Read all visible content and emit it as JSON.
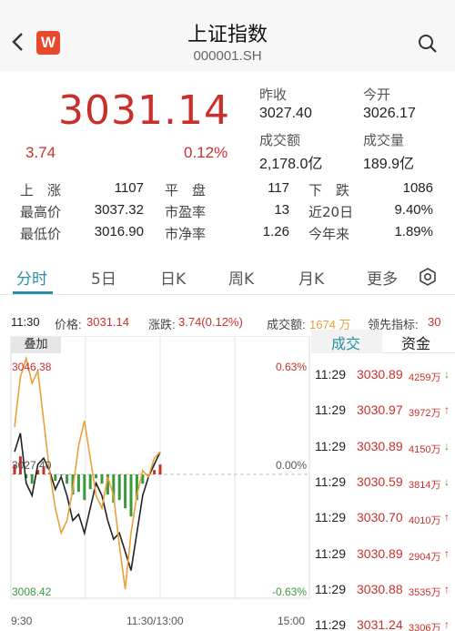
{
  "header": {
    "title": "上证指数",
    "code": "000001.SH",
    "logo_letter": "W"
  },
  "quote": {
    "price": "3031.14",
    "change": "3.74",
    "change_pct": "0.12%",
    "fields": [
      {
        "label": "昨收",
        "value": "3027.40"
      },
      {
        "label": "今开",
        "value": "3026.17"
      },
      {
        "label": "成交额",
        "value": "2,178.0亿"
      },
      {
        "label": "成交量",
        "value": "189.9亿"
      }
    ]
  },
  "stats": [
    {
      "label": "上　涨",
      "value": "1107"
    },
    {
      "label": "平　盘",
      "value": "117"
    },
    {
      "label": "下　跌",
      "value": "1086"
    },
    {
      "label": "最高价",
      "value": "3037.32"
    },
    {
      "label": "市盈率",
      "value": "13"
    },
    {
      "label": "近20日",
      "value": "9.40%"
    },
    {
      "label": "最低价",
      "value": "3016.90"
    },
    {
      "label": "市净率",
      "value": "1.26"
    },
    {
      "label": "今年来",
      "value": "1.89%"
    }
  ],
  "tabs": [
    "分时",
    "5日",
    "日K",
    "周K",
    "月K",
    "更多"
  ],
  "info_bar": {
    "time": "11:30",
    "price_label": "价格:",
    "price": "3031.14",
    "change_label": "涨跌:",
    "change": "3.74(0.12%)",
    "volume_label": "成交额:",
    "volume": "1674 万",
    "leader_label": "领先指标:",
    "leader": "30"
  },
  "chart": {
    "overlay_label": "叠加",
    "y_top": "3046.38",
    "y_mid": "3027.40",
    "y_bottom": "3008.42",
    "pct_top": "0.63%",
    "pct_mid": "0.00%",
    "pct_bottom": "-0.63%",
    "x_start": "9:30",
    "x_mid": "11:30/13:00",
    "x_end": "15:00"
  },
  "chart_data": {
    "type": "line",
    "x_range": [
      "9:30",
      "15:00"
    ],
    "ylim": [
      3008.42,
      3046.38
    ],
    "baseline": 3027.4,
    "series": [
      {
        "values": [
          3031,
          3034,
          3026,
          3024,
          3029,
          3030,
          3028,
          3025,
          3027,
          3024,
          3020,
          3021,
          3018,
          3022,
          3026,
          3024,
          3020,
          3017,
          3018,
          3015,
          3012,
          3018,
          3024,
          3027,
          3029,
          3031
        ]
      },
      {
        "values": [
          3035,
          3043,
          3046,
          3042,
          3044,
          3036,
          3028,
          3022,
          3018,
          3020,
          3025,
          3032,
          3036,
          3030,
          3024,
          3022,
          3027,
          3024,
          3016,
          3009,
          3018,
          3024,
          3028,
          3027,
          3030,
          3031
        ]
      }
    ],
    "colors": {
      "up": "#c8312b",
      "down": "#3a9a3a",
      "line_black": "#222222",
      "line_orange": "#e8a23a"
    }
  },
  "trade_tabs": [
    "成交",
    "资金"
  ],
  "trades": [
    {
      "time": "11:29",
      "price": "3030.89",
      "vol": "4259万",
      "dir": "↓"
    },
    {
      "time": "11:29",
      "price": "3030.97",
      "vol": "3972万",
      "dir": "↑"
    },
    {
      "time": "11:29",
      "price": "3030.89",
      "vol": "4150万",
      "dir": "↓"
    },
    {
      "time": "11:29",
      "price": "3030.59",
      "vol": "3814万",
      "dir": "↓"
    },
    {
      "time": "11:29",
      "price": "3030.70",
      "vol": "4010万",
      "dir": "↑"
    },
    {
      "time": "11:29",
      "price": "3030.89",
      "vol": "2904万",
      "dir": "↑"
    },
    {
      "time": "11:29",
      "price": "3030.88",
      "vol": "3535万",
      "dir": "↑"
    },
    {
      "time": "11:29",
      "price": "3031.24",
      "vol": "3306万",
      "dir": "↑"
    }
  ]
}
